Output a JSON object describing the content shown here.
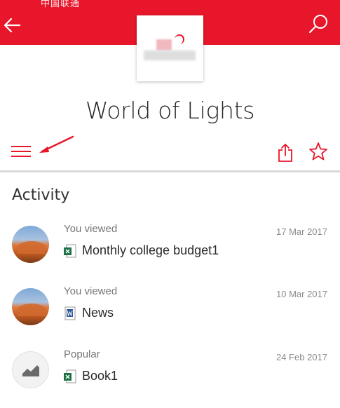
{
  "header": {
    "status_text": "中国联通",
    "accent_color": "#e8162a"
  },
  "site": {
    "title": "World of Lights"
  },
  "toolbar": {
    "menu_icon": "hamburger-menu-icon",
    "share_icon": "share-icon",
    "favorite_icon": "star-icon"
  },
  "activity": {
    "heading": "Activity",
    "items": [
      {
        "label": "You viewed",
        "date": "17 Mar 2017",
        "file": "Monthly college budget1",
        "file_type": "excel",
        "avatar": "photo"
      },
      {
        "label": "You viewed",
        "date": "10 Mar 2017",
        "file": "News",
        "file_type": "word",
        "avatar": "photo"
      },
      {
        "label": "Popular",
        "date": "24 Feb 2017",
        "file": "Book1",
        "file_type": "excel",
        "avatar": "trend"
      }
    ]
  }
}
